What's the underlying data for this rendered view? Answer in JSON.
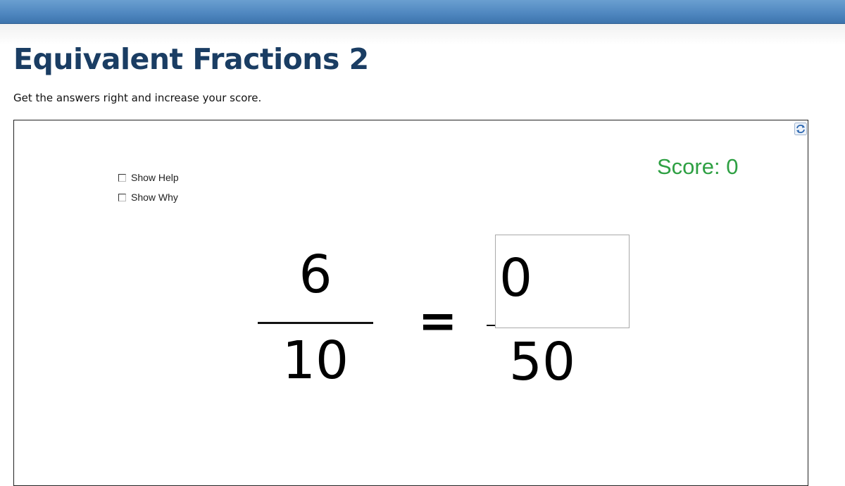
{
  "header": {
    "title": "Equivalent Fractions 2",
    "subtitle": "Get the answers right and increase your score."
  },
  "app": {
    "refresh_icon": "refresh-icon",
    "options": {
      "show_help_label": "Show Help",
      "show_help_checked": false,
      "show_why_label": "Show Why",
      "show_why_checked": false
    },
    "score_text": "Score: 0",
    "score_color": "#2ea043",
    "question": {
      "left_numerator": "6",
      "left_denominator": "10",
      "equals": "=",
      "answer_value": "0",
      "right_denominator": "50"
    }
  }
}
